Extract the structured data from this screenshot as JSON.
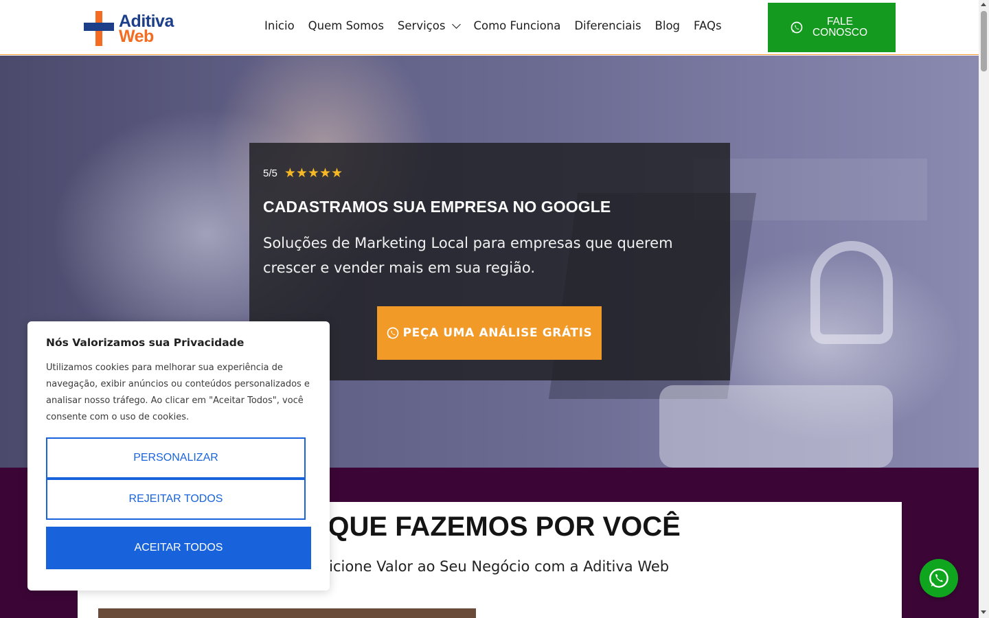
{
  "header": {
    "logo": {
      "line1": "Aditiva",
      "line2": "Web"
    },
    "nav": [
      {
        "label": "Inicio"
      },
      {
        "label": "Quem Somos"
      },
      {
        "label": "Serviços"
      },
      {
        "label": "Como Funciona"
      },
      {
        "label": "Diferenciais"
      },
      {
        "label": "Blog"
      },
      {
        "label": "FAQs"
      }
    ],
    "cta": {
      "label": "FALE CONOSCO",
      "icon": "whatsapp-icon"
    }
  },
  "hero": {
    "rating": {
      "score": "5/5",
      "stars": "★★★★★",
      "value": 5,
      "max": 5
    },
    "title": "CADASTRAMOS SUA EMPRESA NO GOOGLE",
    "subtitle": "Soluções de Marketing Local para empresas que querem crescer e vender mais em sua região.",
    "button": {
      "label": "PEÇA UMA ANÁLISE GRÁTIS",
      "icon": "whatsapp-icon"
    }
  },
  "section": {
    "title": "O QUE FAZEMOS POR VOCÊ",
    "subtitle": "Adicione Valor ao Seu Negócio com a Aditiva Web"
  },
  "cookie": {
    "title": "Nós Valorizamos sua Privacidade",
    "text": "Utilizamos cookies para melhorar sua experiência de navegação, exibir anúncios ou conteúdos personalizados e analisar nosso tráfego. Ao clicar em \"Aceitar Todos\", você consente com o uso de cookies.",
    "personalize": "PERSONALIZAR",
    "reject": "REJEITAR TODOS",
    "accept": "ACEITAR TODOS"
  },
  "colors": {
    "brand_blue": "#1d3f8a",
    "brand_orange": "#f36c21",
    "cta_green": "#149b1f",
    "hero_button": "#f29a28",
    "section_purple": "#3b0636",
    "cookie_blue": "#1863dc",
    "star_yellow": "#f7b825"
  },
  "floating": {
    "icon": "whatsapp-icon"
  }
}
